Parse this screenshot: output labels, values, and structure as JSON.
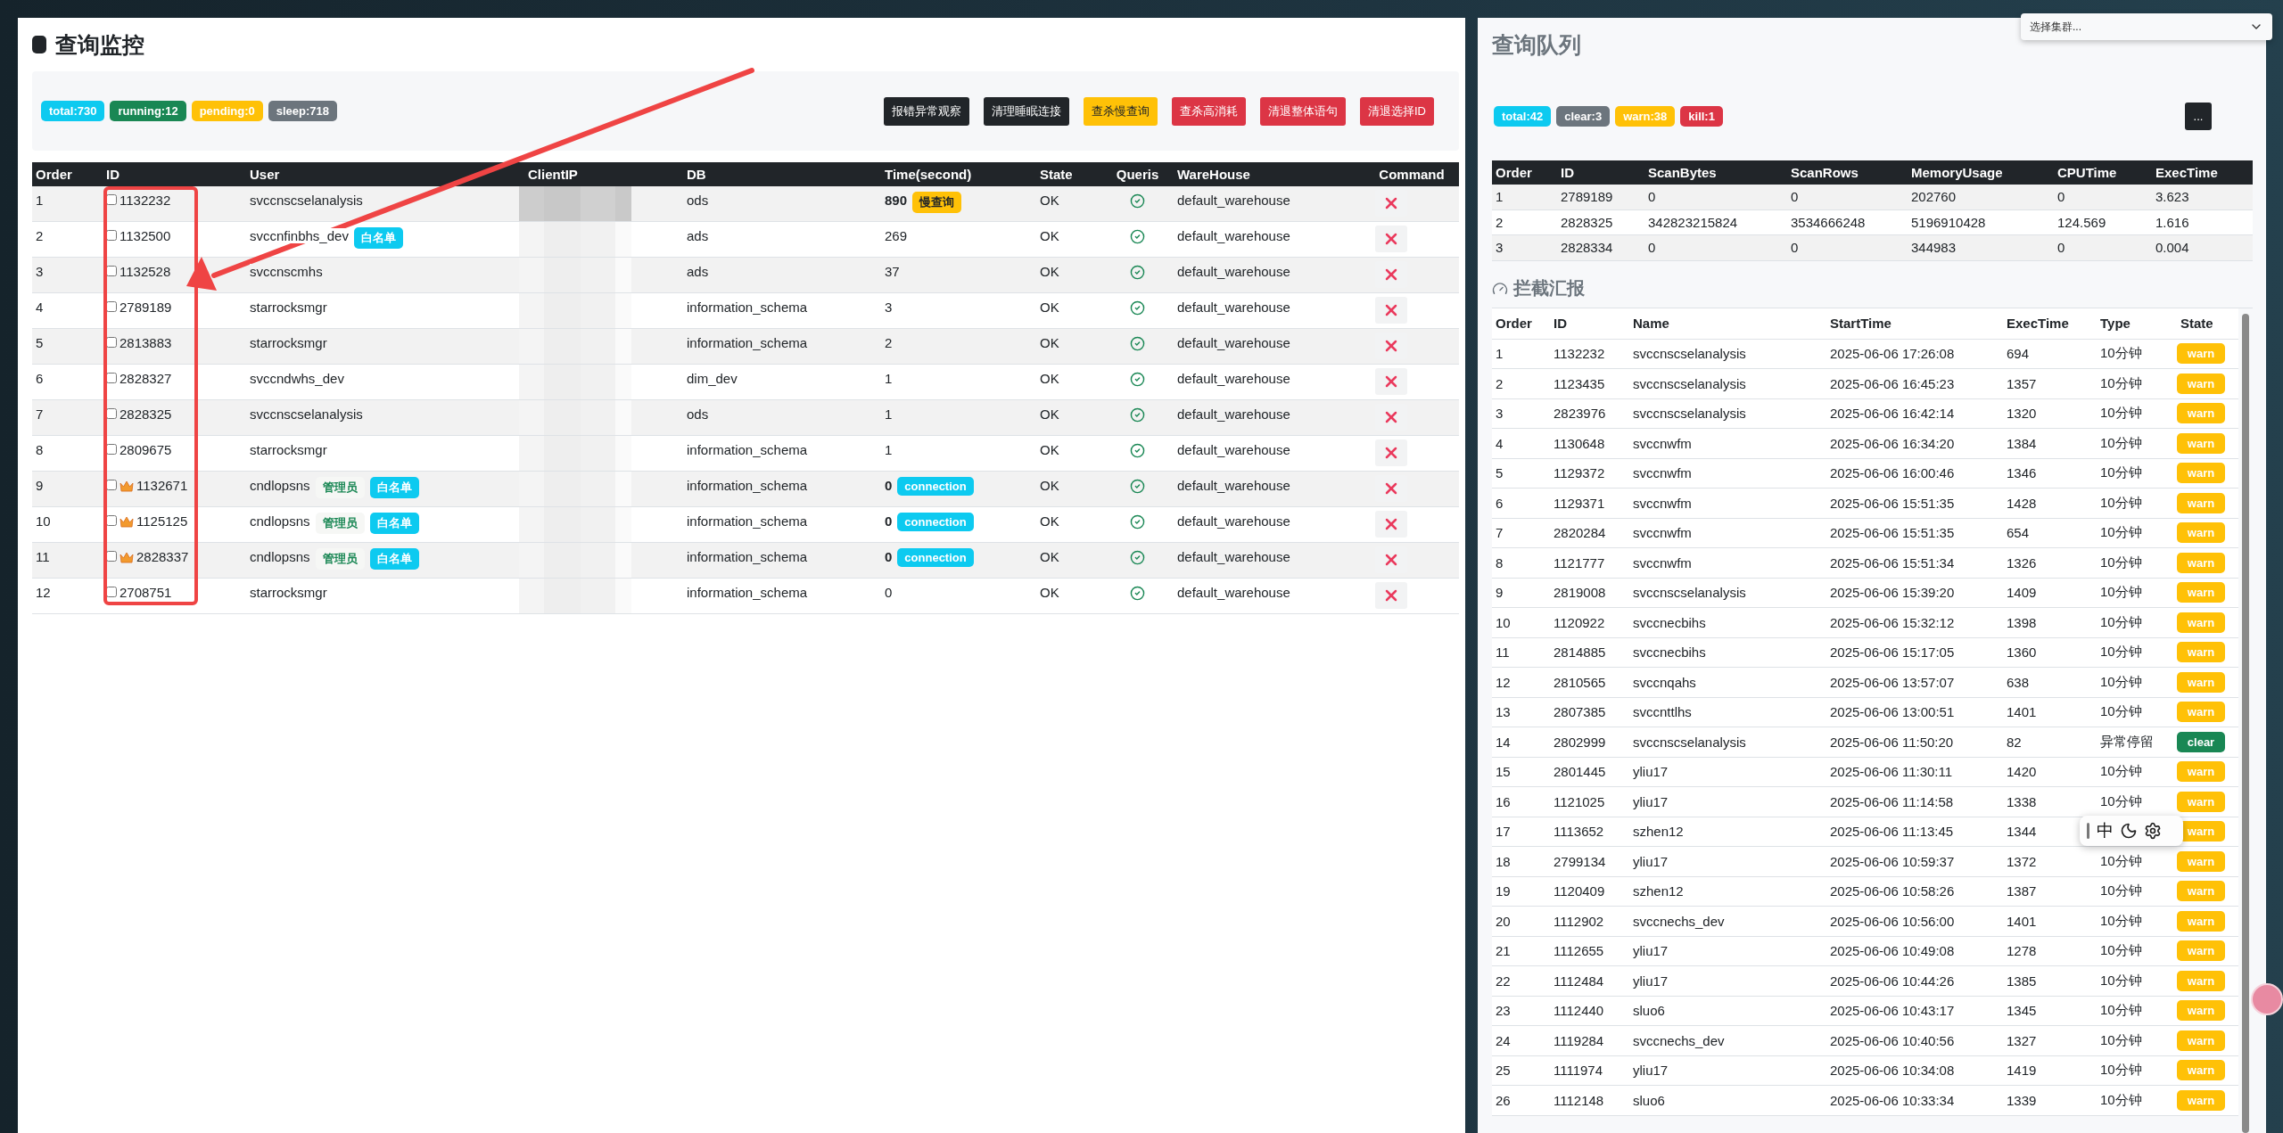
{
  "cluster_select": {
    "placeholder": "选择集群..."
  },
  "monitor": {
    "title": "查询监控",
    "counts": [
      {
        "label": "total:730",
        "color": "#0dcaf0"
      },
      {
        "label": "running:12",
        "color": "#198754"
      },
      {
        "label": "pending:0",
        "color": "#ffc107"
      },
      {
        "label": "sleep:718",
        "color": "#6c757d"
      }
    ],
    "actions": [
      {
        "label": "报错异常观察",
        "kind": "dark"
      },
      {
        "label": "清理睡眠连接",
        "kind": "dark"
      },
      {
        "label": "查杀慢查询",
        "kind": "warning"
      },
      {
        "label": "查杀高消耗",
        "kind": "danger"
      },
      {
        "label": "清退整体语句",
        "kind": "danger"
      },
      {
        "label": "清退选择ID",
        "kind": "danger"
      }
    ],
    "columns": [
      "Order",
      "ID",
      "User",
      "ClientIP",
      "DB",
      "Time(second)",
      "State",
      "Queris",
      "WareHouse",
      "Command"
    ],
    "rows": [
      {
        "order": "1",
        "id": "1132232",
        "checked": false,
        "crown": false,
        "user": "svccnscselanalysis",
        "user_tags": [],
        "db": "ods",
        "time": "890",
        "time_tag": {
          "kind": "slow",
          "label": "慢查询"
        },
        "state": "OK",
        "warehouse": "default_warehouse"
      },
      {
        "order": "2",
        "id": "1132500",
        "checked": false,
        "crown": false,
        "user": "svccnfinbhs_dev",
        "user_tags": [
          {
            "kind": "whitelist",
            "label": "白名单"
          }
        ],
        "db": "ads",
        "time": "269",
        "state": "OK",
        "warehouse": "default_warehouse"
      },
      {
        "order": "3",
        "id": "1132528",
        "checked": false,
        "crown": false,
        "user": "svccnscmhs",
        "user_tags": [],
        "db": "ads",
        "time": "37",
        "state": "OK",
        "warehouse": "default_warehouse"
      },
      {
        "order": "4",
        "id": "2789189",
        "checked": false,
        "crown": false,
        "user": "starrocksmgr",
        "user_tags": [],
        "db": "information_schema",
        "time": "3",
        "state": "OK",
        "warehouse": "default_warehouse"
      },
      {
        "order": "5",
        "id": "2813883",
        "checked": false,
        "crown": false,
        "user": "starrocksmgr",
        "user_tags": [],
        "db": "information_schema",
        "time": "2",
        "state": "OK",
        "warehouse": "default_warehouse"
      },
      {
        "order": "6",
        "id": "2828327",
        "checked": false,
        "crown": false,
        "user": "svccndwhs_dev",
        "user_tags": [],
        "db": "dim_dev",
        "time": "1",
        "state": "OK",
        "warehouse": "default_warehouse"
      },
      {
        "order": "7",
        "id": "2828325",
        "checked": false,
        "crown": false,
        "user": "svccnscselanalysis",
        "user_tags": [],
        "db": "ods",
        "time": "1",
        "state": "OK",
        "warehouse": "default_warehouse"
      },
      {
        "order": "8",
        "id": "2809675",
        "checked": false,
        "crown": false,
        "user": "starrocksmgr",
        "user_tags": [],
        "db": "information_schema",
        "time": "1",
        "state": "OK",
        "warehouse": "default_warehouse"
      },
      {
        "order": "9",
        "id": "1132671",
        "checked": false,
        "crown": true,
        "user": "cndlopsns",
        "user_tags": [
          {
            "kind": "admin",
            "label": "管理员"
          },
          {
            "kind": "whitelist",
            "label": "白名单"
          }
        ],
        "db": "information_schema",
        "time": "0",
        "time_tag": {
          "kind": "connection",
          "label": "connection"
        },
        "state": "OK",
        "warehouse": "default_warehouse"
      },
      {
        "order": "10",
        "id": "1125125",
        "checked": false,
        "crown": true,
        "user": "cndlopsns",
        "user_tags": [
          {
            "kind": "admin",
            "label": "管理员"
          },
          {
            "kind": "whitelist",
            "label": "白名单"
          }
        ],
        "db": "information_schema",
        "time": "0",
        "time_tag": {
          "kind": "connection",
          "label": "connection"
        },
        "state": "OK",
        "warehouse": "default_warehouse"
      },
      {
        "order": "11",
        "id": "2828337",
        "checked": false,
        "crown": true,
        "user": "cndlopsns",
        "user_tags": [
          {
            "kind": "admin",
            "label": "管理员"
          },
          {
            "kind": "whitelist",
            "label": "白名单"
          }
        ],
        "db": "information_schema",
        "time": "0",
        "time_tag": {
          "kind": "connection",
          "label": "connection"
        },
        "state": "OK",
        "warehouse": "default_warehouse"
      },
      {
        "order": "12",
        "id": "2708751",
        "checked": false,
        "crown": false,
        "user": "starrocksmgr",
        "user_tags": [],
        "db": "information_schema",
        "time": "0",
        "state": "OK",
        "warehouse": "default_warehouse"
      }
    ]
  },
  "queue": {
    "title": "查询队列",
    "counts": [
      {
        "label": "total:42",
        "color": "#0dcaf0"
      },
      {
        "label": "clear:3",
        "color": "#6c757d"
      },
      {
        "label": "warn:38",
        "color": "#ffc107"
      },
      {
        "label": "kill:1",
        "color": "#dc3545"
      }
    ],
    "more_button": "...",
    "columns": [
      "Order",
      "ID",
      "ScanBytes",
      "ScanRows",
      "MemoryUsage",
      "CPUTime",
      "ExecTime"
    ],
    "rows": [
      [
        "1",
        "2789189",
        "0",
        "0",
        "202760",
        "0",
        "3.623"
      ],
      [
        "2",
        "2828325",
        "342823215824",
        "3534666248",
        "5196910428",
        "124.569",
        "1.616"
      ],
      [
        "3",
        "2828334",
        "0",
        "0",
        "344983",
        "0",
        "0.004"
      ]
    ]
  },
  "report": {
    "title": "拦截汇报",
    "columns": [
      "Order",
      "ID",
      "Name",
      "StartTime",
      "ExecTime",
      "Type",
      "State"
    ],
    "rows": [
      {
        "cells": [
          "1",
          "1132232",
          "svccnscselanalysis",
          "2025-06-06 17:26:08",
          "694",
          "10分钟"
        ],
        "state": "warn",
        "kind": "warn"
      },
      {
        "cells": [
          "2",
          "1123435",
          "svccnscselanalysis",
          "2025-06-06 16:45:23",
          "1357",
          "10分钟"
        ],
        "state": "warn",
        "kind": "warn"
      },
      {
        "cells": [
          "3",
          "2823976",
          "svccnscselanalysis",
          "2025-06-06 16:42:14",
          "1320",
          "10分钟"
        ],
        "state": "warn",
        "kind": "warn"
      },
      {
        "cells": [
          "4",
          "1130648",
          "svccnwfm",
          "2025-06-06 16:34:20",
          "1384",
          "10分钟"
        ],
        "state": "warn",
        "kind": "warn"
      },
      {
        "cells": [
          "5",
          "1129372",
          "svccnwfm",
          "2025-06-06 16:00:46",
          "1346",
          "10分钟"
        ],
        "state": "warn",
        "kind": "warn"
      },
      {
        "cells": [
          "6",
          "1129371",
          "svccnwfm",
          "2025-06-06 15:51:35",
          "1428",
          "10分钟"
        ],
        "state": "warn",
        "kind": "warn"
      },
      {
        "cells": [
          "7",
          "2820284",
          "svccnwfm",
          "2025-06-06 15:51:35",
          "654",
          "10分钟"
        ],
        "state": "warn",
        "kind": "warn"
      },
      {
        "cells": [
          "8",
          "1121777",
          "svccnwfm",
          "2025-06-06 15:51:34",
          "1326",
          "10分钟"
        ],
        "state": "warn",
        "kind": "warn"
      },
      {
        "cells": [
          "9",
          "2819008",
          "svccnscselanalysis",
          "2025-06-06 15:39:20",
          "1409",
          "10分钟"
        ],
        "state": "warn",
        "kind": "warn"
      },
      {
        "cells": [
          "10",
          "1120922",
          "svccnecbihs",
          "2025-06-06 15:32:12",
          "1398",
          "10分钟"
        ],
        "state": "warn",
        "kind": "warn"
      },
      {
        "cells": [
          "11",
          "2814885",
          "svccnecbihs",
          "2025-06-06 15:17:05",
          "1360",
          "10分钟"
        ],
        "state": "warn",
        "kind": "warn"
      },
      {
        "cells": [
          "12",
          "2810565",
          "svccnqahs",
          "2025-06-06 13:57:07",
          "638",
          "10分钟"
        ],
        "state": "warn",
        "kind": "warn"
      },
      {
        "cells": [
          "13",
          "2807385",
          "svccnttlhs",
          "2025-06-06 13:00:51",
          "1401",
          "10分钟"
        ],
        "state": "warn",
        "kind": "warn"
      },
      {
        "cells": [
          "14",
          "2802999",
          "svccnscselanalysis",
          "2025-06-06 11:50:20",
          "82",
          "异常停留"
        ],
        "state": "clear",
        "kind": "clear"
      },
      {
        "cells": [
          "15",
          "2801445",
          "yliu17",
          "2025-06-06 11:30:11",
          "1420",
          "10分钟"
        ],
        "state": "warn",
        "kind": "warn"
      },
      {
        "cells": [
          "16",
          "1121025",
          "yliu17",
          "2025-06-06 11:14:58",
          "1338",
          "10分钟"
        ],
        "state": "warn",
        "kind": "warn"
      },
      {
        "cells": [
          "17",
          "1113652",
          "szhen12",
          "2025-06-06 11:13:45",
          "1344"
        ],
        "state": "warn",
        "kind": "warn"
      },
      {
        "cells": [
          "18",
          "2799134",
          "yliu17",
          "2025-06-06 10:59:37",
          "1372",
          "10分钟"
        ],
        "state": "warn",
        "kind": "warn"
      },
      {
        "cells": [
          "19",
          "1120409",
          "szhen12",
          "2025-06-06 10:58:26",
          "1387",
          "10分钟"
        ],
        "state": "warn",
        "kind": "warn"
      },
      {
        "cells": [
          "20",
          "1112902",
          "svccnechs_dev",
          "2025-06-06 10:56:00",
          "1401",
          "10分钟"
        ],
        "state": "warn",
        "kind": "warn"
      },
      {
        "cells": [
          "21",
          "1112655",
          "yliu17",
          "2025-06-06 10:49:08",
          "1278",
          "10分钟"
        ],
        "state": "warn",
        "kind": "warn"
      },
      {
        "cells": [
          "22",
          "1112484",
          "yliu17",
          "2025-06-06 10:44:26",
          "1385",
          "10分钟"
        ],
        "state": "warn",
        "kind": "warn"
      },
      {
        "cells": [
          "23",
          "1112440",
          "sluo6",
          "2025-06-06 10:43:17",
          "1345",
          "10分钟"
        ],
        "state": "warn",
        "kind": "warn"
      },
      {
        "cells": [
          "24",
          "1119284",
          "svccnechs_dev",
          "2025-06-06 10:40:56",
          "1327",
          "10分钟"
        ],
        "state": "warn",
        "kind": "warn"
      },
      {
        "cells": [
          "25",
          "1111974",
          "yliu17",
          "2025-06-06 10:34:08",
          "1419",
          "10分钟"
        ],
        "state": "warn",
        "kind": "warn"
      },
      {
        "cells": [
          "26",
          "1112148",
          "sluo6",
          "2025-06-06 10:33:34",
          "1339",
          "10分钟"
        ],
        "state": "warn",
        "kind": "warn"
      }
    ]
  },
  "ime_toolbar": {
    "mode": "中"
  }
}
